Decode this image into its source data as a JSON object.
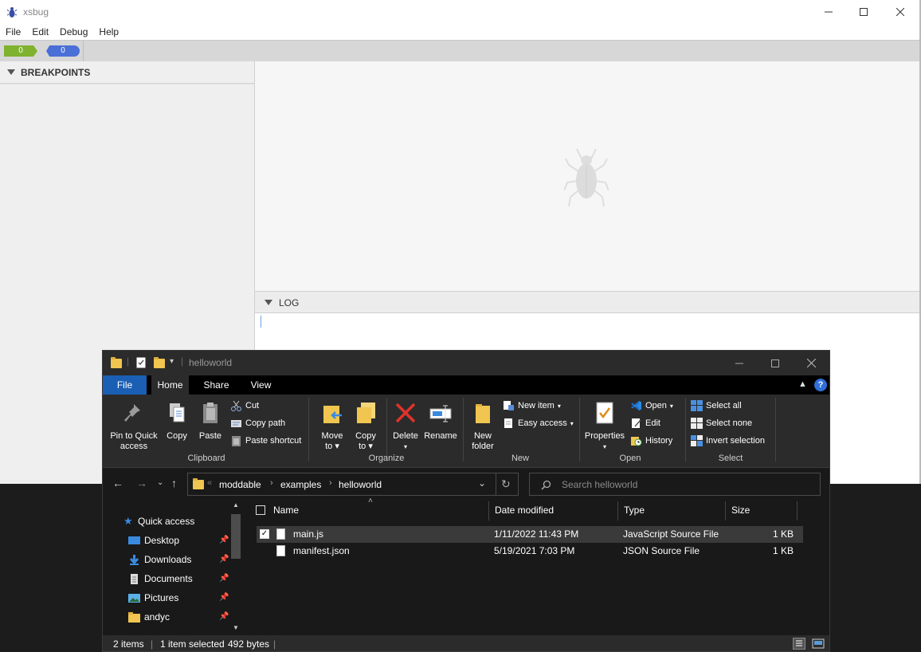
{
  "xsbug": {
    "title": "xsbug",
    "menu": [
      "File",
      "Edit",
      "Debug",
      "Help"
    ],
    "badge_green": "0",
    "badge_blue": "0",
    "breakpoints_label": "BREAKPOINTS",
    "log_label": "LOG"
  },
  "explorer": {
    "title": "helloworld",
    "tabs": {
      "file": "File",
      "home": "Home",
      "share": "Share",
      "view": "View"
    },
    "clipboard": {
      "pin": "Pin to Quick access",
      "pin_line1": "Pin to Quick",
      "pin_line2": "access",
      "copy": "Copy",
      "paste": "Paste",
      "cut": "Cut",
      "copy_path": "Copy path",
      "paste_shortcut": "Paste shortcut",
      "group": "Clipboard"
    },
    "organize": {
      "move_to_1": "Move",
      "move_to_2": "to",
      "copy_to_1": "Copy",
      "copy_to_2": "to",
      "delete": "Delete",
      "rename": "Rename",
      "group": "Organize"
    },
    "new": {
      "new_folder_1": "New",
      "new_folder_2": "folder",
      "new_item": "New item",
      "easy_access": "Easy access",
      "group": "New"
    },
    "open": {
      "properties": "Properties",
      "open": "Open",
      "edit": "Edit",
      "history": "History",
      "group": "Open"
    },
    "select": {
      "select_all": "Select all",
      "select_none": "Select none",
      "invert": "Invert selection",
      "group": "Select"
    },
    "breadcrumb": [
      "moddable",
      "examples",
      "helloworld"
    ],
    "breadcrumb_overflow": "«",
    "search_placeholder": "Search helloworld",
    "nav": [
      {
        "label": "Quick access",
        "icon": "star-icon"
      },
      {
        "label": "Desktop",
        "icon": "desktop-icon"
      },
      {
        "label": "Downloads",
        "icon": "download-icon"
      },
      {
        "label": "Documents",
        "icon": "documents-icon"
      },
      {
        "label": "Pictures",
        "icon": "pictures-icon"
      },
      {
        "label": "andyc",
        "icon": "folder-icon"
      }
    ],
    "columns": {
      "name": "Name",
      "date": "Date modified",
      "type": "Type",
      "size": "Size"
    },
    "files": [
      {
        "name": "main.js",
        "date": "1/11/2022 11:43 PM",
        "type": "JavaScript Source File",
        "size": "1 KB",
        "selected": true
      },
      {
        "name": "manifest.json",
        "date": "5/19/2021 7:03 PM",
        "type": "JSON Source File",
        "size": "1 KB",
        "selected": false
      }
    ],
    "status": {
      "items": "2 items",
      "selected": "1 item selected",
      "size": "492 bytes"
    }
  }
}
